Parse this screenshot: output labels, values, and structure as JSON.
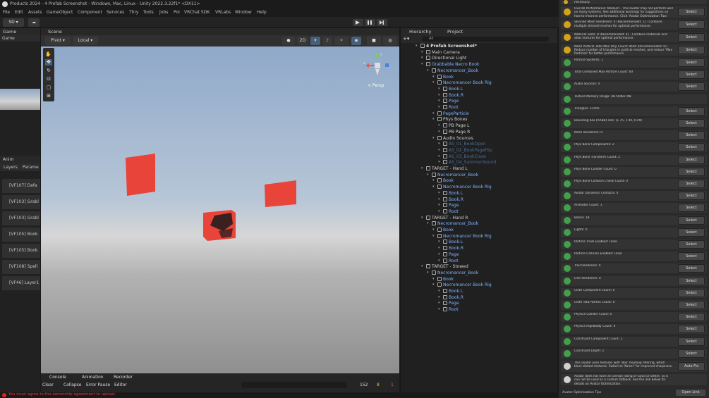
{
  "window": {
    "title": "Products 2024 - 4 Prefab Screenshot - Windows, Mac, Linux - Unity 2022.3.22f1* <DX11>"
  },
  "menu": [
    "File",
    "Edit",
    "Assets",
    "GameObject",
    "Component",
    "Services",
    "Thry",
    "Tools",
    "Jobs",
    "Poi",
    "VRChat SDK",
    "VRLabs",
    "Window",
    "Help"
  ],
  "toolbar": {
    "account": "SD"
  },
  "game_panel": {
    "tab": "Game",
    "dropdown": "Game"
  },
  "anim_panel": {
    "tab": "Anim",
    "layers_tab": "Layers",
    "params_tab": "Parame",
    "items": [
      "[VF107] Defa",
      "[VF103] Grabl",
      "[VF103] Grabl",
      "[VF105] Book",
      "[VF105] Book",
      "[VF108] Spell",
      "[VF46] Layer1"
    ]
  },
  "scene": {
    "tab": "Scene",
    "pivot": "Pivot",
    "local": "Local",
    "mode2d": "2D",
    "persp": "< Persp",
    "gizmo_y": "y",
    "gizmo_x": "x"
  },
  "hierarchy": {
    "tab": "Hierarchy",
    "project_tab": "Project",
    "search": "All",
    "items": [
      {
        "label": "4 Prefab Screenshot*",
        "depth": 0,
        "color": "#e0e0e0",
        "bold": true
      },
      {
        "label": "Main Camera",
        "depth": 1,
        "color": "#cfcfcf"
      },
      {
        "label": "Directional Light",
        "depth": 1,
        "color": "#cfcfcf"
      },
      {
        "label": "Grabbable Necro Book",
        "depth": 1,
        "color": "#7fb2ff"
      },
      {
        "label": "Necromancer_Book",
        "depth": 2,
        "color": "#7fb2ff"
      },
      {
        "label": "Book",
        "depth": 3,
        "color": "#7fb2ff"
      },
      {
        "label": "Necromancer Book Rig",
        "depth": 3,
        "color": "#7fb2ff"
      },
      {
        "label": "Book.L",
        "depth": 4,
        "color": "#7fb2ff"
      },
      {
        "label": "Book.R",
        "depth": 4,
        "color": "#7fb2ff"
      },
      {
        "label": "Page",
        "depth": 4,
        "color": "#7fb2ff"
      },
      {
        "label": "Root",
        "depth": 4,
        "color": "#7fb2ff"
      },
      {
        "label": "PageParticle",
        "depth": 3,
        "color": "#7fb2ff"
      },
      {
        "label": "Phys Bones",
        "depth": 3,
        "color": "#cfcfcf"
      },
      {
        "label": "PB Page L",
        "depth": 4,
        "color": "#cfcfcf"
      },
      {
        "label": "PB Page R",
        "depth": 4,
        "color": "#cfcfcf"
      },
      {
        "label": "Audio Sources",
        "depth": 3,
        "color": "#cfcfcf"
      },
      {
        "label": "AS_01_BookOpen",
        "depth": 4,
        "color": "#4a6e99"
      },
      {
        "label": "AS_02_BookPageFlip",
        "depth": 4,
        "color": "#4a6e99"
      },
      {
        "label": "AS_03_BookClose",
        "depth": 4,
        "color": "#4a6e99"
      },
      {
        "label": "AS_04_SummonSound",
        "depth": 4,
        "color": "#4a6e99"
      },
      {
        "label": "TARGET - Hand L",
        "depth": 1,
        "color": "#cfcfcf"
      },
      {
        "label": "Necromancer_Book",
        "depth": 2,
        "color": "#7fb2ff"
      },
      {
        "label": "Book",
        "depth": 3,
        "color": "#7fb2ff"
      },
      {
        "label": "Necromancer Book Rig",
        "depth": 3,
        "color": "#7fb2ff"
      },
      {
        "label": "Book.L",
        "depth": 4,
        "color": "#7fb2ff"
      },
      {
        "label": "Book.R",
        "depth": 4,
        "color": "#7fb2ff"
      },
      {
        "label": "Page",
        "depth": 4,
        "color": "#7fb2ff"
      },
      {
        "label": "Root",
        "depth": 4,
        "color": "#7fb2ff"
      },
      {
        "label": "TARGET - Hand R",
        "depth": 1,
        "color": "#cfcfcf"
      },
      {
        "label": "Necromancer_Book",
        "depth": 2,
        "color": "#7fb2ff"
      },
      {
        "label": "Book",
        "depth": 3,
        "color": "#7fb2ff"
      },
      {
        "label": "Necromancer Book Rig",
        "depth": 3,
        "color": "#7fb2ff"
      },
      {
        "label": "Book.L",
        "depth": 4,
        "color": "#7fb2ff"
      },
      {
        "label": "Book.R",
        "depth": 4,
        "color": "#7fb2ff"
      },
      {
        "label": "Page",
        "depth": 4,
        "color": "#7fb2ff"
      },
      {
        "label": "Root",
        "depth": 4,
        "color": "#7fb2ff"
      },
      {
        "label": "TARGET - Stowed",
        "depth": 1,
        "color": "#cfcfcf"
      },
      {
        "label": "Necromancer_Book",
        "depth": 2,
        "color": "#7fb2ff"
      },
      {
        "label": "Book",
        "depth": 3,
        "color": "#7fb2ff"
      },
      {
        "label": "Necromancer Book Rig",
        "depth": 3,
        "color": "#7fb2ff"
      },
      {
        "label": "Book.L",
        "depth": 4,
        "color": "#7fb2ff"
      },
      {
        "label": "Book.R",
        "depth": 4,
        "color": "#7fb2ff"
      },
      {
        "label": "Page",
        "depth": 4,
        "color": "#7fb2ff"
      },
      {
        "label": "Root",
        "depth": 4,
        "color": "#7fb2ff"
      }
    ]
  },
  "validation": {
    "rows": [
      {
        "text": "necessary.",
        "type": "warn",
        "button": ""
      },
      {
        "text": "Overall Performance: Medium - This avatar may not perform well on many systems. See additional warnings for suggestions on how to improve performance. Click 'Avatar Optimization Tips' below for more information.",
        "type": "warn",
        "button": "Select"
      },
      {
        "text": "Skinned Mesh Renderers: 4 (Recommended: 1) - Combine multiple skinned meshes for optimal performance.",
        "type": "warn",
        "button": "Select"
      },
      {
        "text": "Material Slots: 8 (Recommended: 4) - Combine materials and atlas textures for optimal performance.",
        "type": "warn",
        "button": "Select"
      },
      {
        "text": "Mesh Particle Total Max Poly Count: 9600 (Recommended: 0) - Reduce number of triangles in particle meshes, and reduce 'Max Particles' for better performance.",
        "type": "warn",
        "button": "Select"
      },
      {
        "text": "Particle Systems: 1",
        "type": "info",
        "button": "Select"
      },
      {
        "text": "Total Combined Max Particle Count: 60",
        "type": "info",
        "button": "Select"
      },
      {
        "text": "Audio Sources: 4",
        "type": "info",
        "button": "Select"
      },
      {
        "text": "Texture Memory Usage: 48.50481 MB",
        "type": "info",
        "button": ""
      },
      {
        "text": "Triangles: 31456",
        "type": "ok",
        "button": "Select"
      },
      {
        "text": "Bounding box (AABB) size: (1.75, 1.40, 0.49)",
        "type": "ok",
        "button": "Select"
      },
      {
        "text": "Mesh Renderers: 0",
        "type": "ok",
        "button": "Select"
      },
      {
        "text": "Phys Bone Components: 2",
        "type": "ok",
        "button": "Select"
      },
      {
        "text": "Phys Bone Transform Count: 2",
        "type": "ok",
        "button": "Select"
      },
      {
        "text": "Phys Bone Collider Count: 0",
        "type": "ok",
        "button": "Select"
      },
      {
        "text": "Phys Bone Collision Check Count: 0",
        "type": "ok",
        "button": "Select"
      },
      {
        "text": "Avatar Dynamics Contacts: 0",
        "type": "ok",
        "button": "Select"
      },
      {
        "text": "Animator Count: 1",
        "type": "ok",
        "button": "Select"
      },
      {
        "text": "Bones: 18",
        "type": "ok",
        "button": "Select"
      },
      {
        "text": "Lights: 0",
        "type": "ok",
        "button": "Select"
      },
      {
        "text": "Particle Trails Enabled: False",
        "type": "ok",
        "button": "Select"
      },
      {
        "text": "Particle Collision Enabled: False",
        "type": "ok",
        "button": "Select"
      },
      {
        "text": "Trail Renderers: 0",
        "type": "ok",
        "button": "Select"
      },
      {
        "text": "Line Renderers: 0",
        "type": "ok",
        "button": "Select"
      },
      {
        "text": "Cloth Component Count: 0",
        "type": "ok",
        "button": "Select"
      },
      {
        "text": "Cloth Total Vertex Count: 0",
        "type": "ok",
        "button": "Select"
      },
      {
        "text": "Physics Collider Count: 0",
        "type": "ok",
        "button": "Select"
      },
      {
        "text": "Physics Rigidbody Count: 0",
        "type": "ok",
        "button": "Select"
      },
      {
        "text": "Constraint Component Count: 2",
        "type": "ok",
        "button": "Select"
      },
      {
        "text": "Constraint Depth: 2",
        "type": "ok",
        "button": "Select"
      },
      {
        "text": "This avatar uses textures with 'Box' mipmap filtering, which blurs distant textures. Switch to 'Kaiser' for improved sharpness.",
        "type": "alert",
        "button": "Auto Fix"
      },
      {
        "text": "Avatar does not have an overall rating of Good or better, so it can not be used as a custom fallback. See the link below for details on Avatar Optimization.",
        "type": "alert",
        "button": ""
      }
    ],
    "tips_label": "Avatar Optimization Tips",
    "open_link": "Open Link"
  },
  "console": {
    "tabs": [
      "Console",
      "Animation",
      "Recorder"
    ],
    "clear": "Clear",
    "collapse": "Collapse",
    "error_pause": "Error Pause",
    "editor": "Editor",
    "count_log": "152",
    "count_warn": "8",
    "count_err": "1"
  },
  "status": {
    "message": "You must agree to the ownership agreement to upload."
  },
  "colors": {
    "warn": "#d4a21a",
    "ok": "#43a04a",
    "alert": "#d0d0d0",
    "error": "#e02020",
    "cube": "#e8443a"
  }
}
